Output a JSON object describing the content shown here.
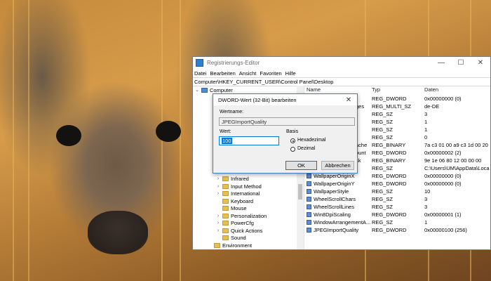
{
  "window": {
    "title": "Registrierungs-Editor",
    "controls": {
      "minimize": "—",
      "maximize": "☐",
      "close": "✕"
    },
    "menu": [
      "Datei",
      "Bearbeiten",
      "Ansicht",
      "Favoriten",
      "Hilfe"
    ],
    "address": "Computer\\HKEY_CURRENT_USER\\Control Panel\\Desktop"
  },
  "tree": [
    {
      "label": "Computer",
      "expander": "⌄",
      "icon": "computer-icon"
    },
    {
      "label": "Infrared",
      "expander": "›",
      "icon": "folder-icon"
    },
    {
      "label": "Input Method",
      "expander": "›",
      "icon": "folder-icon"
    },
    {
      "label": "International",
      "expander": "›",
      "icon": "folder-icon"
    },
    {
      "label": "Keyboard",
      "expander": "",
      "icon": "folder-icon"
    },
    {
      "label": "Mouse",
      "expander": "",
      "icon": "folder-icon"
    },
    {
      "label": "Personalization",
      "expander": "›",
      "icon": "folder-icon"
    },
    {
      "label": "PowerCfg",
      "expander": "›",
      "icon": "folder-icon"
    },
    {
      "label": "Quick Actions",
      "expander": "›",
      "icon": "folder-icon"
    },
    {
      "label": "Sound",
      "expander": "",
      "icon": "folder-icon"
    },
    {
      "label": "Environment",
      "expander": "",
      "icon": "folder-icon"
    }
  ],
  "list": {
    "columns": [
      "Name",
      "Typ",
      "Daten"
    ],
    "rows": [
      {
        "name": "",
        "type": "REG_DWORD",
        "data": "0x00000000 (0)"
      },
      {
        "name": "ges",
        "type": "REG_MULTI_SZ",
        "data": "de-DE"
      },
      {
        "name": "",
        "type": "REG_SZ",
        "data": "3"
      },
      {
        "name": "",
        "type": "REG_SZ",
        "data": "1"
      },
      {
        "name": "",
        "type": "REG_SZ",
        "data": "1"
      },
      {
        "name": "",
        "type": "REG_SZ",
        "data": "0"
      },
      {
        "name": "ache",
        "type": "REG_BINARY",
        "data": "7a c3 01 00 a9 c3 1d 00 20"
      },
      {
        "name": "ount",
        "type": "REG_DWORD",
        "data": "0x00000002 (2)"
      },
      {
        "name": "sk",
        "type": "REG_BINARY",
        "data": "9e 1e 06 80 12 00 00 00"
      },
      {
        "name": "",
        "type": "REG_SZ",
        "data": "C:\\Users\\UM\\AppData\\Loca"
      },
      {
        "name": "WallpaperOriginX",
        "type": "REG_DWORD",
        "data": "0x00000000 (0)"
      },
      {
        "name": "WallpaperOriginY",
        "type": "REG_DWORD",
        "data": "0x00000000 (0)"
      },
      {
        "name": "WallpaperStyle",
        "type": "REG_SZ",
        "data": "10"
      },
      {
        "name": "WheelScrollChars",
        "type": "REG_SZ",
        "data": "3"
      },
      {
        "name": "WheelScrollLines",
        "type": "REG_SZ",
        "data": "3"
      },
      {
        "name": "Win8DpiScaling",
        "type": "REG_DWORD",
        "data": "0x00000001 (1)"
      },
      {
        "name": "WindowArrangementA...",
        "type": "REG_SZ",
        "data": "1"
      },
      {
        "name": "JPEGImportQuality",
        "type": "REG_DWORD",
        "data": "0x00000100 (256)"
      }
    ]
  },
  "dialog": {
    "title": "DWORD-Wert (32-Bit) bearbeiten",
    "close": "✕",
    "name_label": "Wertname:",
    "name_value": "JPEGImportQuality",
    "value_label": "Wert:",
    "value": "100",
    "base_label": "Basis",
    "hex_label": "Hexadezimal",
    "dec_label": "Dezimal",
    "selected_base": "Hexadezimal",
    "ok_label": "OK",
    "cancel_label": "Abbrechen"
  }
}
